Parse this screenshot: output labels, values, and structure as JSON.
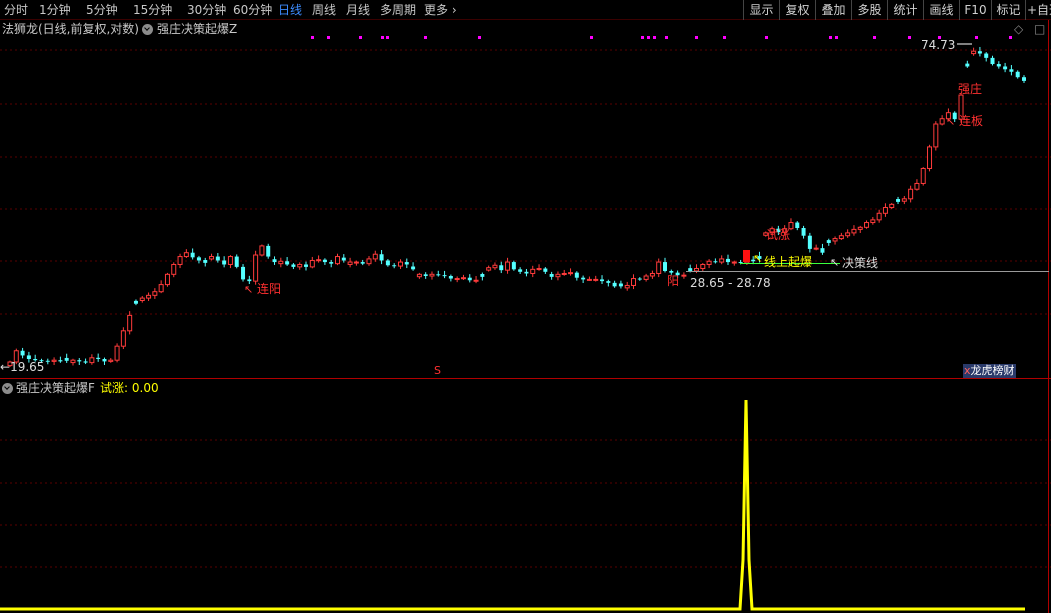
{
  "toolbar": {
    "periods": [
      "分时",
      "1分钟",
      "5分钟",
      "15分钟",
      "30分钟",
      "60分钟",
      "日线",
      "周线",
      "月线",
      "多周期",
      "更多"
    ],
    "active_period": "日线",
    "more_chevron": "chevron-right-icon",
    "tools": [
      "显示",
      "复权",
      "叠加",
      "多股",
      "统计",
      "画线",
      "F10",
      "标记",
      "+自选"
    ]
  },
  "main_panel": {
    "stock_info": "法狮龙(日线,前复权,对数)",
    "indicator_name": "强庄决策起爆Z",
    "high_price": "74.73",
    "low_price": "19.65",
    "range_label": "28.65 - 28.78",
    "annotations": {
      "lianyang": "连阳",
      "qiangzhuang": "强庄",
      "lianban": "连板",
      "xianshang_qibao": "线上起爆",
      "juece_xian": "决策线",
      "shizhang": "试涨",
      "qiangyang": "阳"
    },
    "s_marker": "S",
    "badge": "龙虎榜",
    "badge_prefix": "x",
    "badge_suffix": "财"
  },
  "sub_panel": {
    "indicator_name": "强庄决策起爆F",
    "value_label": "试涨",
    "value": "0.00"
  },
  "colors": {
    "up": "#ff3b3b",
    "down": "#54ffff",
    "background": "#000000",
    "grid": "#5a0000",
    "signal_line": "#ffff00",
    "marker_dot": "#ff00ff"
  },
  "chart_data": {
    "type": "candlestick",
    "scale": "log",
    "y_high": 74.73,
    "y_low": 19.65,
    "closes": [
      19.65,
      20.6,
      20.2,
      19.9,
      19.8,
      19.75,
      19.7,
      19.8,
      19.7,
      19.75,
      19.8,
      19.7,
      19.6,
      20.0,
      19.9,
      19.7,
      19.8,
      21.0,
      22.4,
      23.9,
      25.1,
      25.7,
      26.0,
      26.4,
      27.2,
      28.4,
      29.6,
      30.6,
      31.1,
      30.5,
      30.1,
      29.8,
      30.6,
      30.1,
      29.6,
      30.6,
      29.3,
      27.8,
      27.6,
      30.8,
      32.0,
      30.6,
      29.9,
      30.0,
      29.6,
      29.3,
      29.6,
      29.3,
      30.1,
      30.2,
      29.9,
      29.7,
      30.6,
      30.1,
      29.9,
      29.9,
      29.7,
      30.3,
      30.9,
      30.1,
      29.5,
      29.4,
      29.9,
      29.6,
      29.0,
      28.4,
      28.2,
      28.4,
      28.3,
      28.2,
      27.9,
      27.9,
      28.0,
      27.7,
      27.7,
      28.1,
      29.2,
      29.5,
      28.9,
      29.9,
      29.0,
      28.7,
      28.5,
      29.0,
      29.1,
      28.7,
      28.1,
      28.4,
      28.5,
      28.6,
      28.0,
      27.8,
      27.8,
      27.8,
      27.6,
      27.4,
      27.0,
      27.0,
      27.1,
      27.9,
      27.8,
      28.2,
      28.5,
      29.9,
      28.8,
      28.6,
      28.3,
      28.3,
      28.8,
      29.1,
      29.6,
      30.0,
      29.9,
      30.3,
      29.9,
      29.9,
      29.8,
      30.2,
      30.0,
      30.3,
      33.8,
      34.4,
      33.9,
      34.4,
      35.3,
      34.5,
      33.4,
      31.6,
      31.7,
      31.1,
      32.4,
      33.0,
      33.4,
      33.8,
      34.3,
      34.6,
      35.3,
      35.7,
      36.7,
      37.6,
      38.1,
      38.5,
      39.0,
      40.6,
      41.6,
      44.3,
      48.5,
      53.4,
      54.6,
      56.0,
      54.5,
      60.3,
      68.0,
      72.5,
      71.8,
      70.5,
      68.7,
      68.0,
      67.2,
      66.5,
      65.0,
      64.0
    ]
  }
}
